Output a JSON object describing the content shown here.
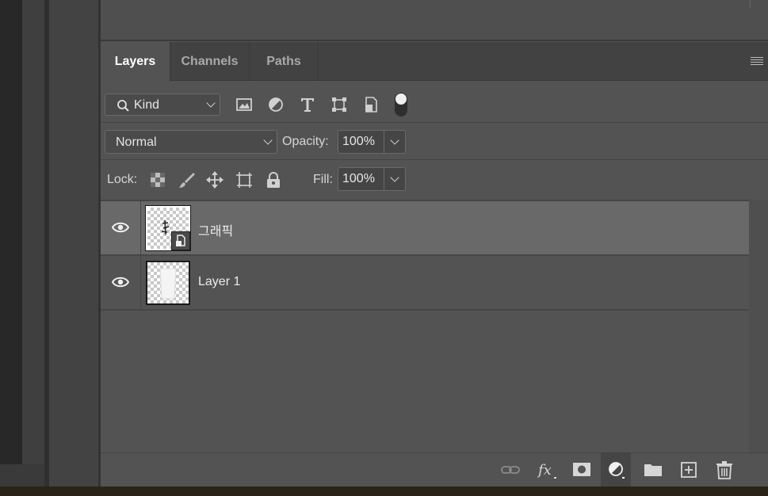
{
  "tabs": [
    {
      "label": "Layers",
      "active": true
    },
    {
      "label": "Channels",
      "active": false
    },
    {
      "label": "Paths",
      "active": false
    }
  ],
  "filter": {
    "kind_label": "Kind",
    "icons": [
      "image-filter-icon",
      "adjustment-filter-icon",
      "type-filter-icon",
      "shape-filter-icon",
      "smart-object-filter-icon"
    ]
  },
  "blend": {
    "mode": "Normal",
    "opacity_label": "Opacity:",
    "opacity_value": "100%"
  },
  "lock": {
    "label": "Lock:",
    "fill_label": "Fill:",
    "fill_value": "100%"
  },
  "layers": [
    {
      "name": "그래픽",
      "selected": true,
      "visible": true,
      "smart_object": true
    },
    {
      "name": "Layer 1",
      "selected": false,
      "visible": true,
      "smart_object": false
    }
  ],
  "bottom_icons": [
    "link-layers-icon",
    "fx-icon",
    "layer-mask-icon",
    "adjustment-layer-icon",
    "group-folder-icon",
    "new-layer-icon",
    "trash-icon"
  ],
  "colors": {
    "panel": "#535353",
    "tabbar": "#424242",
    "selected_row": "#696969"
  }
}
